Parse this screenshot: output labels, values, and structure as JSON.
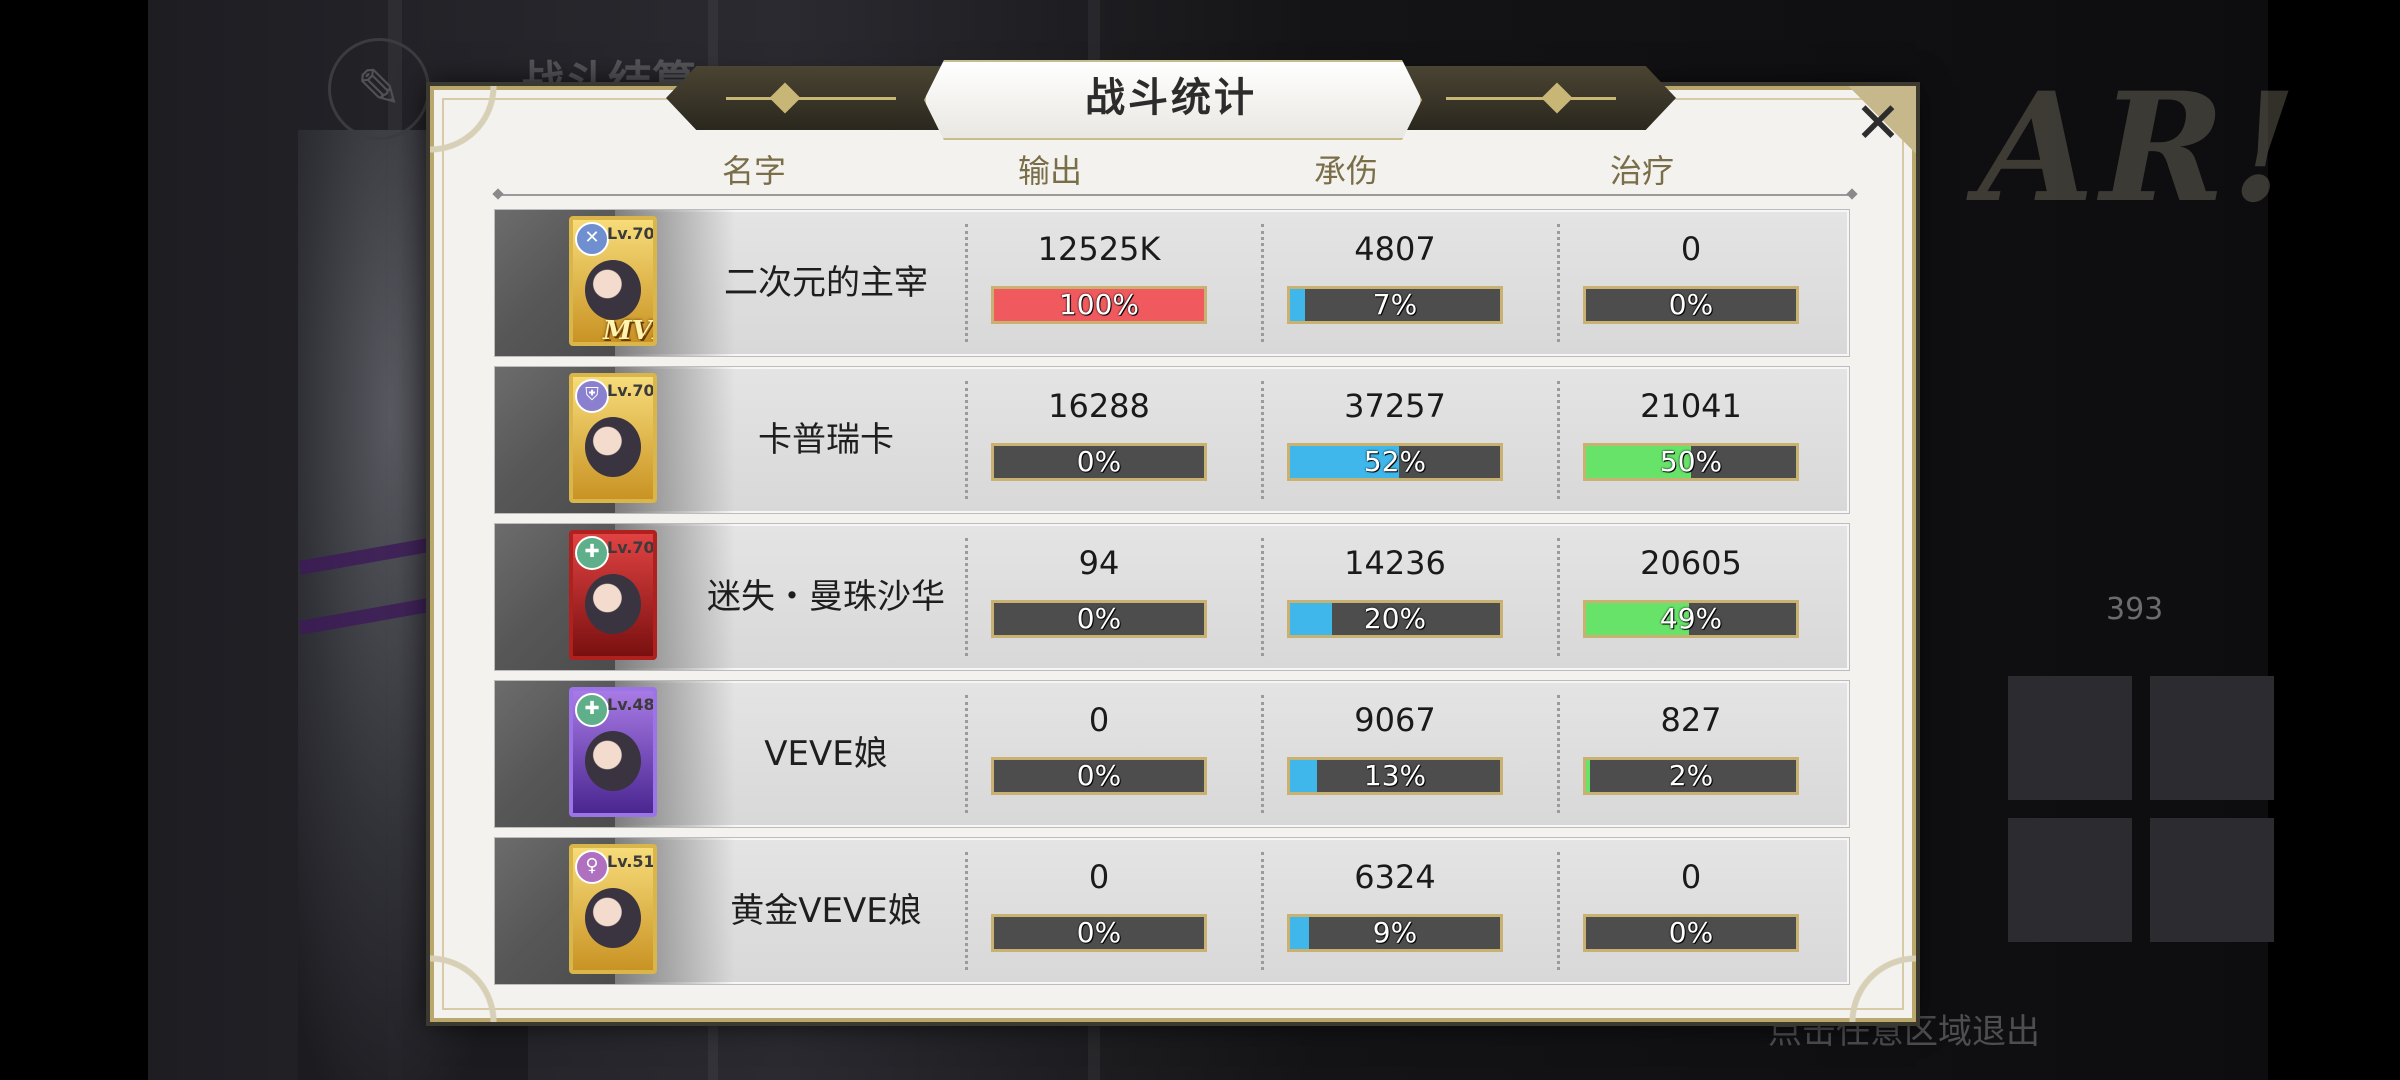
{
  "background": {
    "screen_title": "战斗结算",
    "hint": "点击任意区域退出",
    "side_number": "393",
    "logo_text": "AR!"
  },
  "dialog": {
    "title": "战斗统计",
    "close_glyph": "✕",
    "headers": {
      "name": "名字",
      "output": "输出",
      "damage_taken": "承伤",
      "healing": "治疗"
    }
  },
  "colors": {
    "output_fill": "#f05a5f",
    "damage_taken_fill": "#3fb7ea",
    "healing_fill": "#67e36a",
    "bar_bg": "#4d4d4d",
    "frame_gold": "#c9b171"
  },
  "rows": [
    {
      "level": "Lv.70",
      "mvp": "MVP",
      "class_icon": "bow-icon",
      "frame": "gold",
      "name": "二次元的主宰",
      "output": {
        "value": "12525K",
        "pct_label": "100%",
        "fraction": 1.0
      },
      "taken": {
        "value": "4807",
        "pct_label": "7%",
        "fraction": 0.07
      },
      "heal": {
        "value": "0",
        "pct_label": "0%",
        "fraction": 0.0
      }
    },
    {
      "level": "Lv.70",
      "mvp": "",
      "class_icon": "shield-icon",
      "frame": "gold",
      "name": "卡普瑞卡",
      "output": {
        "value": "16288",
        "pct_label": "0%",
        "fraction": 0.0
      },
      "taken": {
        "value": "37257",
        "pct_label": "52%",
        "fraction": 0.52
      },
      "heal": {
        "value": "21041",
        "pct_label": "50%",
        "fraction": 0.5
      }
    },
    {
      "level": "Lv.70",
      "mvp": "",
      "class_icon": "cross-icon",
      "frame": "red",
      "name": "迷失・曼珠沙华",
      "output": {
        "value": "94",
        "pct_label": "0%",
        "fraction": 0.0
      },
      "taken": {
        "value": "14236",
        "pct_label": "20%",
        "fraction": 0.2
      },
      "heal": {
        "value": "20605",
        "pct_label": "49%",
        "fraction": 0.49
      }
    },
    {
      "level": "Lv.48",
      "mvp": "",
      "class_icon": "cross-icon",
      "frame": "purple",
      "name": "VEVE娘",
      "output": {
        "value": "0",
        "pct_label": "0%",
        "fraction": 0.0
      },
      "taken": {
        "value": "9067",
        "pct_label": "13%",
        "fraction": 0.13
      },
      "heal": {
        "value": "827",
        "pct_label": "2%",
        "fraction": 0.02
      }
    },
    {
      "level": "Lv.51",
      "mvp": "",
      "class_icon": "staff-icon",
      "frame": "gold",
      "name": "黄金VEVE娘",
      "output": {
        "value": "0",
        "pct_label": "0%",
        "fraction": 0.0
      },
      "taken": {
        "value": "6324",
        "pct_label": "9%",
        "fraction": 0.09
      },
      "heal": {
        "value": "0",
        "pct_label": "0%",
        "fraction": 0.0
      }
    }
  ]
}
